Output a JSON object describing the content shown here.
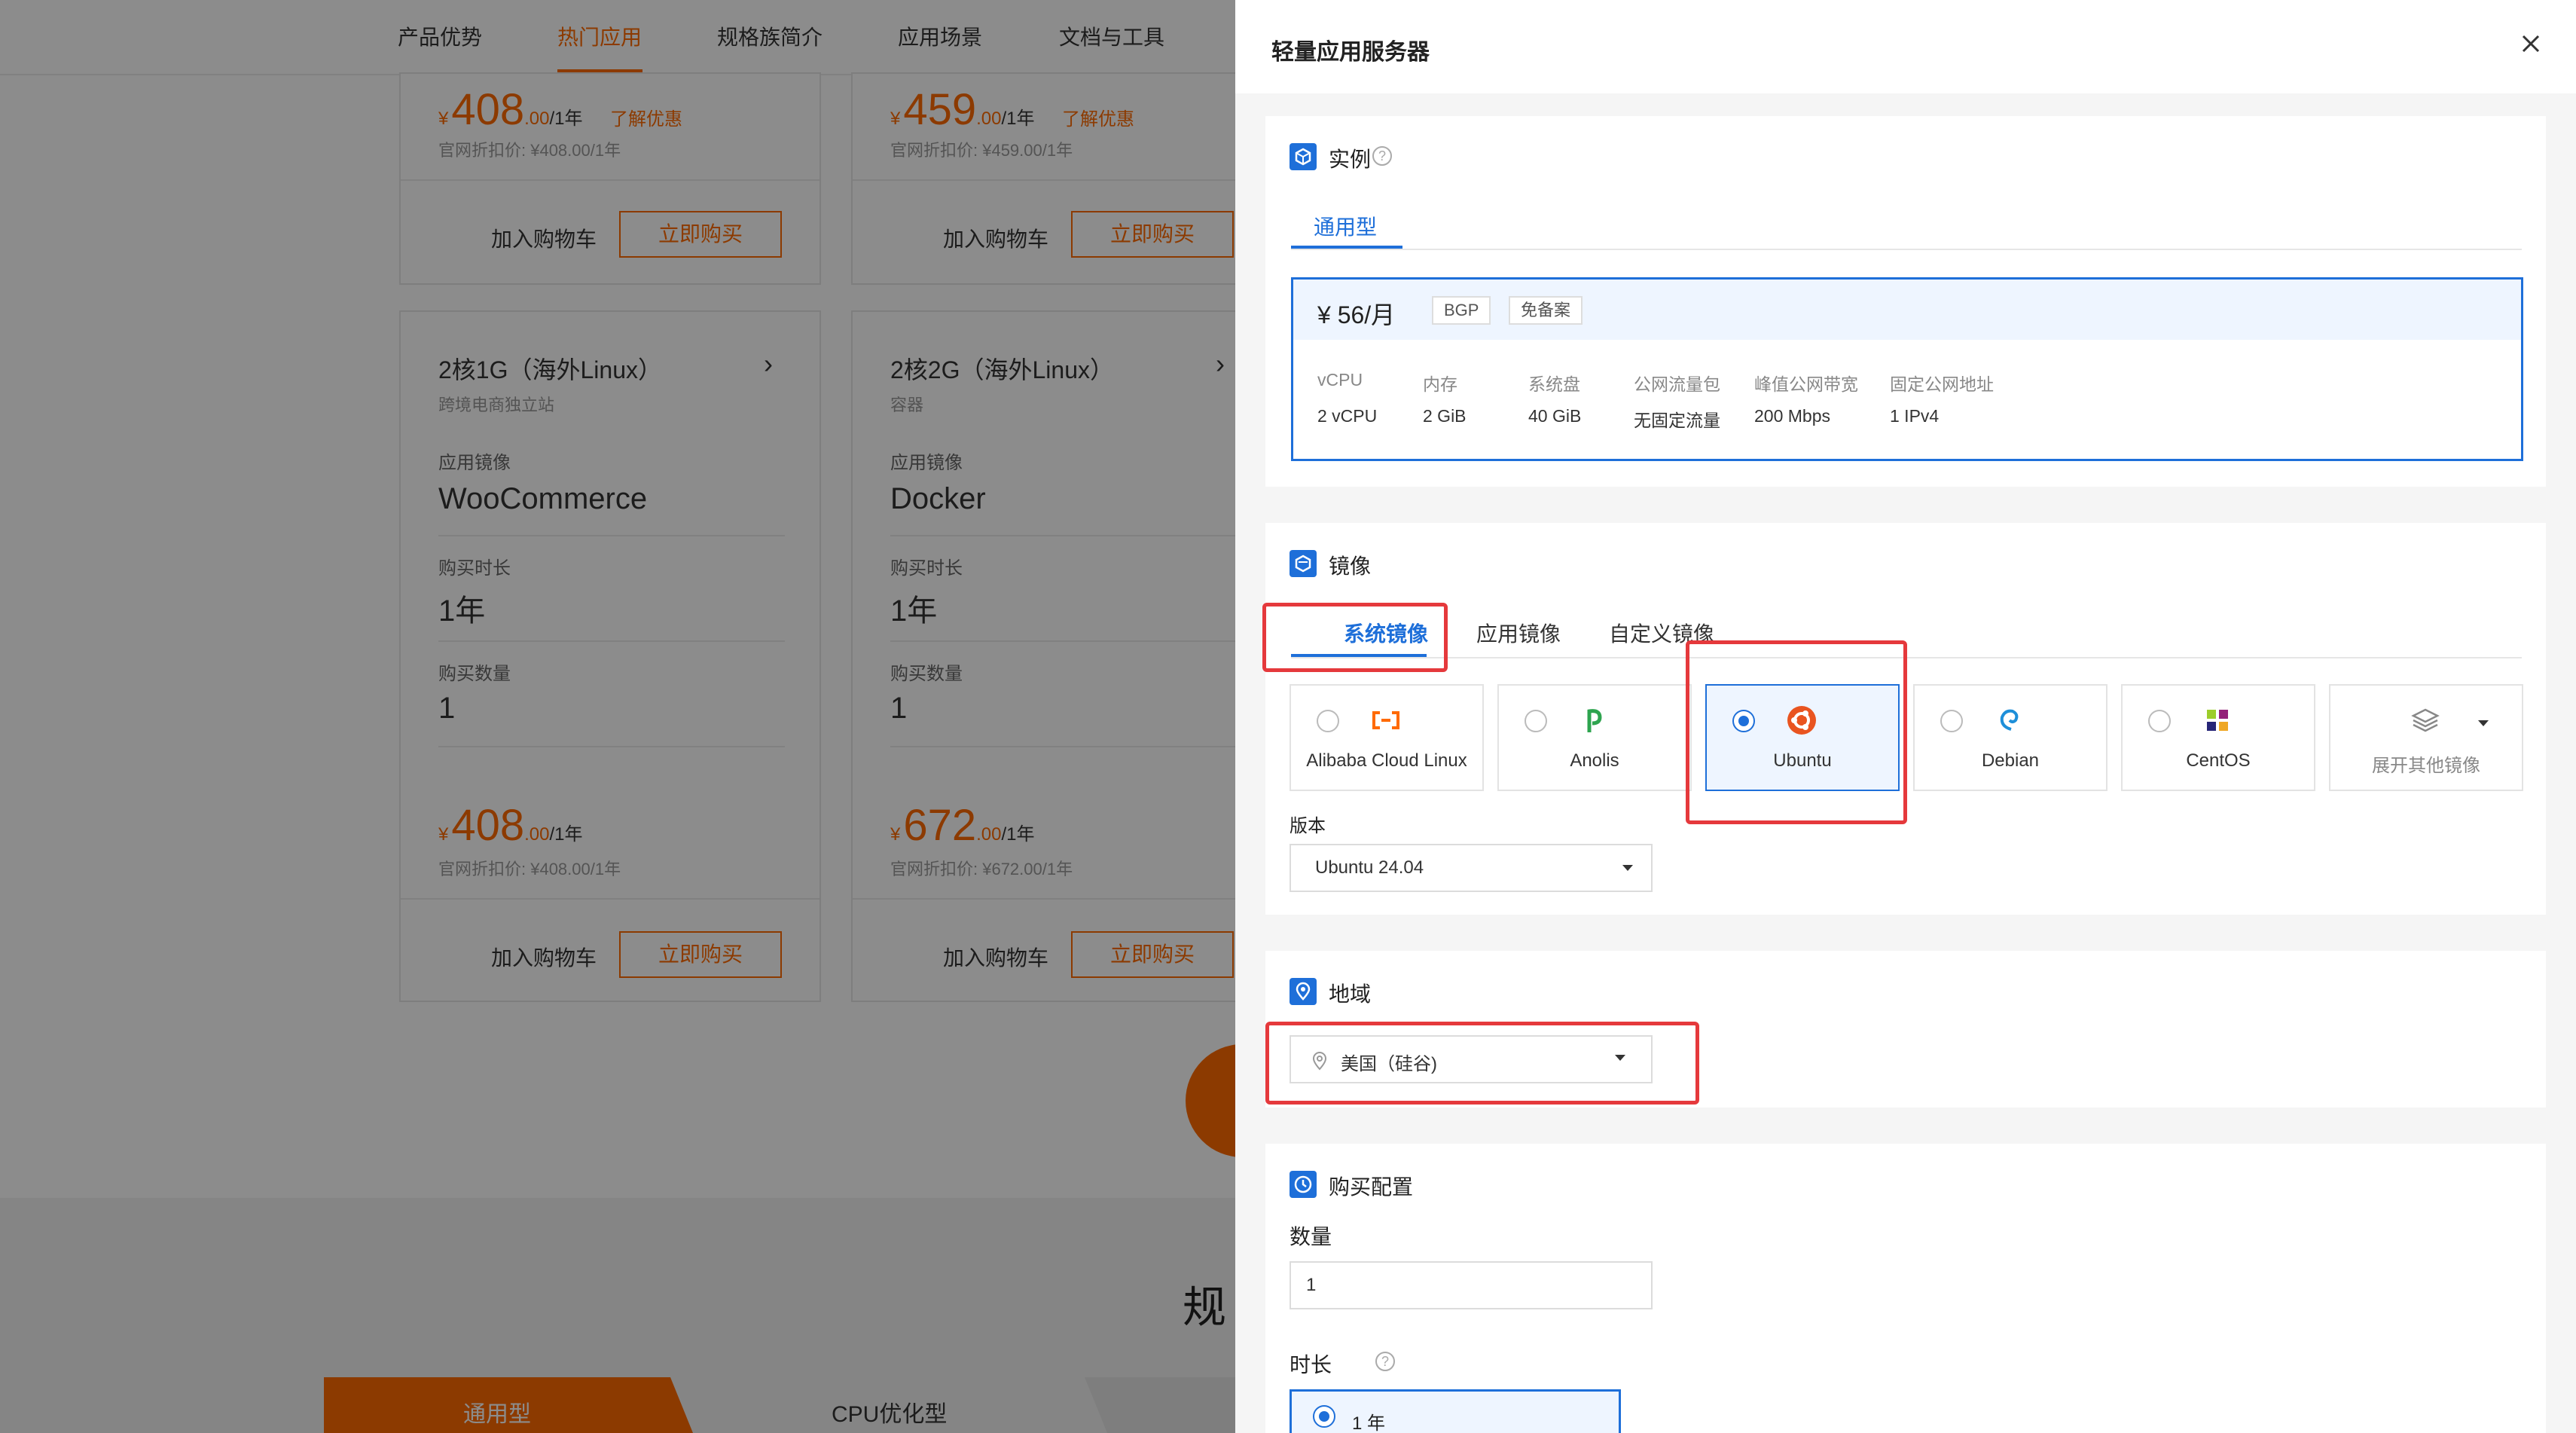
{
  "background": {
    "nav": [
      "产品优势",
      "热门应用",
      "规格族简介",
      "应用场景",
      "文档与工具"
    ],
    "nav_active": "热门应用",
    "cards_top": [
      {
        "price_int": "408",
        "price_dec": ".00",
        "per": "/1年",
        "promo": "了解优惠",
        "orig": "官网折扣价: ¥408.00/1年",
        "cart": "加入购物车",
        "buy": "立即购买"
      },
      {
        "price_int": "459",
        "price_dec": ".00",
        "per": "/1年",
        "promo": "了解优惠",
        "orig": "官网折扣价: ¥459.00/1年",
        "cart": "加入购物车",
        "buy": "立即购买"
      }
    ],
    "cards": [
      {
        "title": "2核1G（海外Linux）",
        "subtitle": "跨境电商独立站",
        "image_label": "应用镜像",
        "image": "WooCommerce",
        "duration_label": "购买时长",
        "duration": "1年",
        "qty_label": "购买数量",
        "qty": "1",
        "price_int": "408",
        "price_dec": ".00",
        "per": "/1年",
        "orig": "官网折扣价: ¥408.00/1年",
        "cart": "加入购物车",
        "buy": "立即购买"
      },
      {
        "title": "2核2G（海外Linux）",
        "subtitle": "容器",
        "image_label": "应用镜像",
        "image": "Docker",
        "duration_label": "购买时长",
        "duration": "1年",
        "qty_label": "购买数量",
        "qty": "1",
        "price_int": "672",
        "price_dec": ".00",
        "per": "/1年",
        "orig": "官网折扣价: ¥672.00/1年",
        "cart": "加入购物车",
        "buy": "立即购买"
      }
    ],
    "currency": "¥",
    "section_heading": "规",
    "bottom_tabs": [
      "通用型",
      "CPU优化型"
    ]
  },
  "drawer": {
    "title": "轻量应用服务器",
    "instance": {
      "title": "实例",
      "tab": "通用型",
      "price": "¥ 56/月",
      "tags": [
        "BGP",
        "免备案"
      ],
      "specs": [
        {
          "label": "vCPU",
          "value": "2 vCPU"
        },
        {
          "label": "内存",
          "value": "2 GiB"
        },
        {
          "label": "系统盘",
          "value": "40 GiB"
        },
        {
          "label": "公网流量包",
          "value": "无固定流量"
        },
        {
          "label": "峰值公网带宽",
          "value": "200 Mbps"
        },
        {
          "label": "固定公网地址",
          "value": "1 IPv4"
        }
      ]
    },
    "image": {
      "title": "镜像",
      "tabs": [
        "系统镜像",
        "应用镜像",
        "自定义镜像"
      ],
      "os": [
        {
          "name": "Alibaba Cloud Linux",
          "icon": "alibaba-cloud-icon",
          "selected": false
        },
        {
          "name": "Anolis",
          "icon": "anolis-icon",
          "selected": false
        },
        {
          "name": "Ubuntu",
          "icon": "ubuntu-icon",
          "selected": true
        },
        {
          "name": "Debian",
          "icon": "debian-icon",
          "selected": false
        },
        {
          "name": "CentOS",
          "icon": "centos-icon",
          "selected": false
        },
        {
          "name": "展开其他镜像",
          "icon": "layers-icon",
          "selected": false
        }
      ],
      "version_label": "版本",
      "version": "Ubuntu 24.04"
    },
    "region": {
      "title": "地域",
      "value": "美国（硅谷)"
    },
    "purchase": {
      "title": "购买配置",
      "qty_label": "数量",
      "qty": "1",
      "duration_label": "时长",
      "duration": "1 年"
    }
  },
  "colors": {
    "accent_blue": "#1e6fd9",
    "accent_orange": "#ff6a00",
    "highlight_red": "#e5393c"
  }
}
